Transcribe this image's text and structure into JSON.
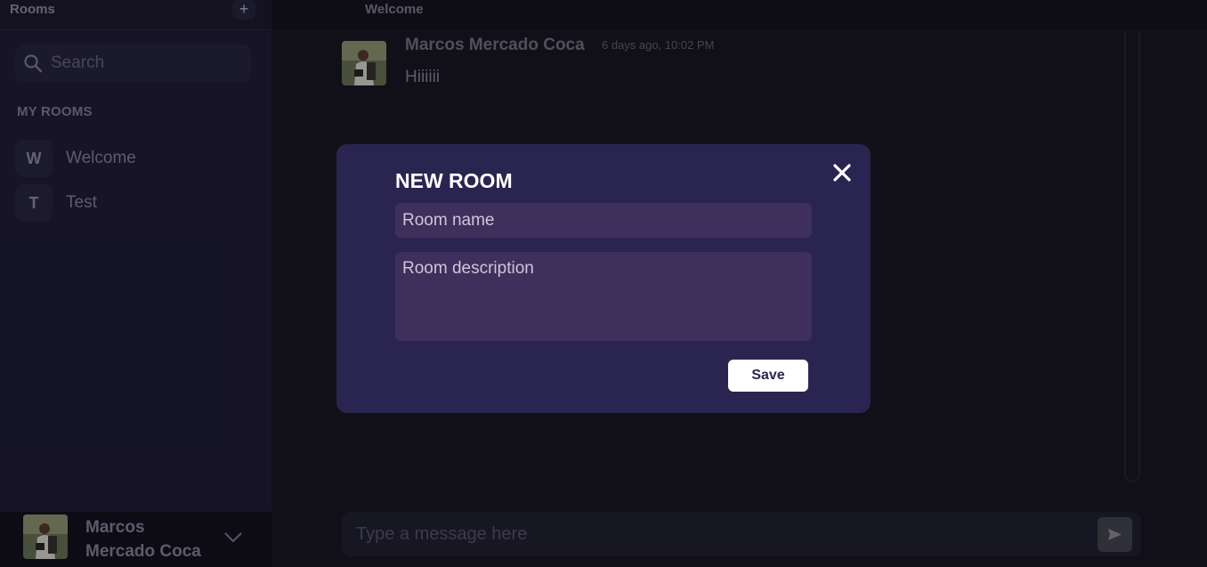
{
  "sidebar": {
    "title": "Rooms",
    "add_label": "+",
    "search": {
      "placeholder": "Search",
      "icon": "search-icon"
    },
    "section_label": "MY ROOMS",
    "rooms": [
      {
        "initial": "W",
        "name": "Welcome"
      },
      {
        "initial": "T",
        "name": "Test"
      }
    ],
    "user": {
      "first_line": "Marcos",
      "second_line": "Mercado Coca"
    }
  },
  "main": {
    "title": "Welcome",
    "messages": [
      {
        "author": "Marcos Mercado Coca",
        "time": "6 days ago, 10:02 PM",
        "text": "Hiiiiii"
      }
    ],
    "composer": {
      "placeholder": "Type a message here",
      "send_icon": "send-icon"
    }
  },
  "modal": {
    "title": "NEW ROOM",
    "name_placeholder": "Room name",
    "description_placeholder": "Room description",
    "save_label": "Save",
    "close_icon": "close-icon"
  },
  "colors": {
    "sidebar_bg": "#22203a",
    "main_bg": "#1b1926",
    "modal_bg": "#2a2550",
    "field_bg": "#3f2f5c",
    "button_bg": "#ffffff"
  }
}
